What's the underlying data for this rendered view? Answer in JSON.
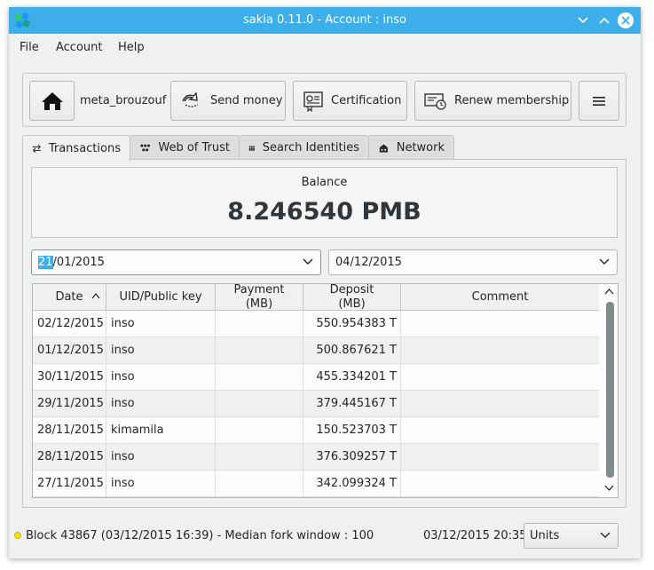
{
  "window": {
    "title": "sakia 0.11.0 - Account : inso"
  },
  "menu": {
    "items": [
      "File",
      "Account",
      "Help"
    ]
  },
  "toolbar": {
    "account_name": "meta_brouzouf",
    "send_money": "Send money",
    "certification": "Certification",
    "renew_membership": "Renew membership"
  },
  "tabs": [
    {
      "label": "Transactions",
      "icon": "transfer-arrows-icon"
    },
    {
      "label": "Web of Trust",
      "icon": "web-of-trust-icon"
    },
    {
      "label": "Search Identities",
      "icon": "people-icon"
    },
    {
      "label": "Network",
      "icon": "network-icon"
    }
  ],
  "balance": {
    "label": "Balance",
    "value": "8.246540 PMB"
  },
  "dates": {
    "from_selected": "21",
    "from_rest": "/01/2015",
    "to": "04/12/2015"
  },
  "table": {
    "headers": {
      "date": "Date",
      "uid": "UID/Public key",
      "payment_line1": "Payment",
      "payment_line2": "(MB)",
      "deposit_line1": "Deposit",
      "deposit_line2": "(MB)",
      "comment": "Comment"
    },
    "rows": [
      {
        "date": "02/12/2015",
        "uid": "inso",
        "payment": "",
        "deposit": "550.954383 T",
        "comment": ""
      },
      {
        "date": "01/12/2015",
        "uid": "inso",
        "payment": "",
        "deposit": "500.867621 T",
        "comment": ""
      },
      {
        "date": "30/11/2015",
        "uid": "inso",
        "payment": "",
        "deposit": "455.334201 T",
        "comment": ""
      },
      {
        "date": "29/11/2015",
        "uid": "inso",
        "payment": "",
        "deposit": "379.445167 T",
        "comment": ""
      },
      {
        "date": "28/11/2015",
        "uid": "kimamila",
        "payment": "",
        "deposit": "150.523703 T",
        "comment": ""
      },
      {
        "date": "28/11/2015",
        "uid": "inso",
        "payment": "",
        "deposit": "376.309257 T",
        "comment": ""
      },
      {
        "date": "27/11/2015",
        "uid": "inso",
        "payment": "",
        "deposit": "342.099324 T",
        "comment": ""
      }
    ]
  },
  "status": {
    "block_text": "Block 43867 (03/12/2015 16:39) - Median fork window : 100",
    "datetime": "03/12/2015 20:35",
    "units": "Units",
    "indicator_color": "#f2e400"
  },
  "colors": {
    "accent": "#3daee9",
    "window_bg": "#eff0f1"
  }
}
